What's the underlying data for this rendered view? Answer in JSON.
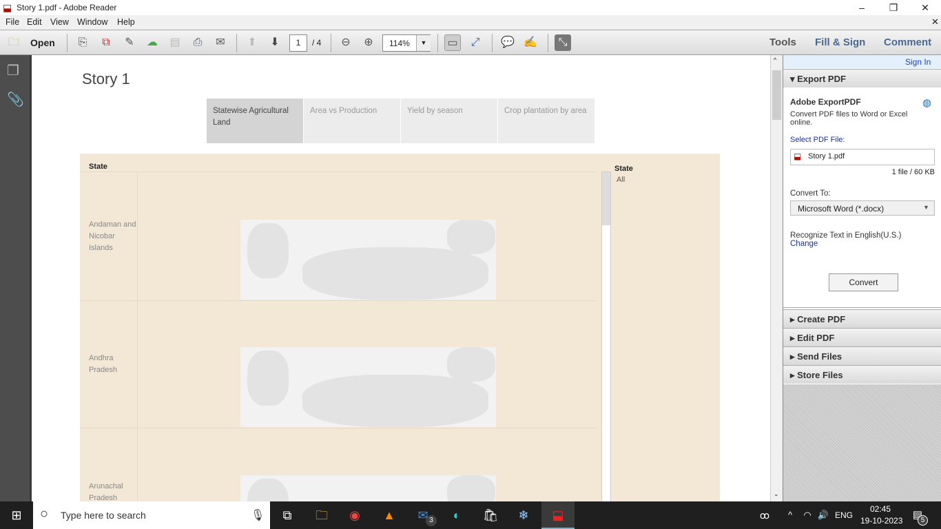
{
  "window": {
    "title": "Story 1.pdf - Adobe Reader",
    "minimize": "–",
    "maximize": "❐",
    "close": "✕"
  },
  "menu": [
    "File",
    "Edit",
    "View",
    "Window",
    "Help"
  ],
  "toolbar": {
    "open": "Open",
    "page_current": "1",
    "page_total": "/ 4",
    "zoom": "114%",
    "tools": "Tools",
    "fill_sign": "Fill & Sign",
    "comment": "Comment"
  },
  "document": {
    "title": "Story 1",
    "tabs": [
      "Statewise Agricultural Land",
      "Area vs Production",
      "Yield by season",
      "Crop plantation by area"
    ],
    "column_header": "State",
    "rows": [
      "Andaman and Nicobar Islands",
      "Andhra Pradesh",
      "Arunachal Pradesh"
    ],
    "filter": {
      "label": "State",
      "value": "All"
    }
  },
  "panel": {
    "sign_in": "Sign In",
    "export_pdf": "Export PDF",
    "adobe_export": "Adobe ExportPDF",
    "description": "Convert PDF files to Word or Excel online.",
    "select_label": "Select PDF File:",
    "file_name": "Story 1.pdf",
    "file_info": "1 file / 60 KB",
    "convert_to": "Convert To:",
    "format": "Microsoft Word (*.docx)",
    "recognize": "Recognize Text in English(U.S.)",
    "change": "Change",
    "convert": "Convert",
    "sections": [
      "Create PDF",
      "Edit PDF",
      "Send Files",
      "Store Files"
    ]
  },
  "taskbar": {
    "search_placeholder": "Type here to search",
    "lang": "ENG",
    "time": "02:45",
    "date": "19-10-2023",
    "mail_badge": "3",
    "notif_badge": "5"
  }
}
